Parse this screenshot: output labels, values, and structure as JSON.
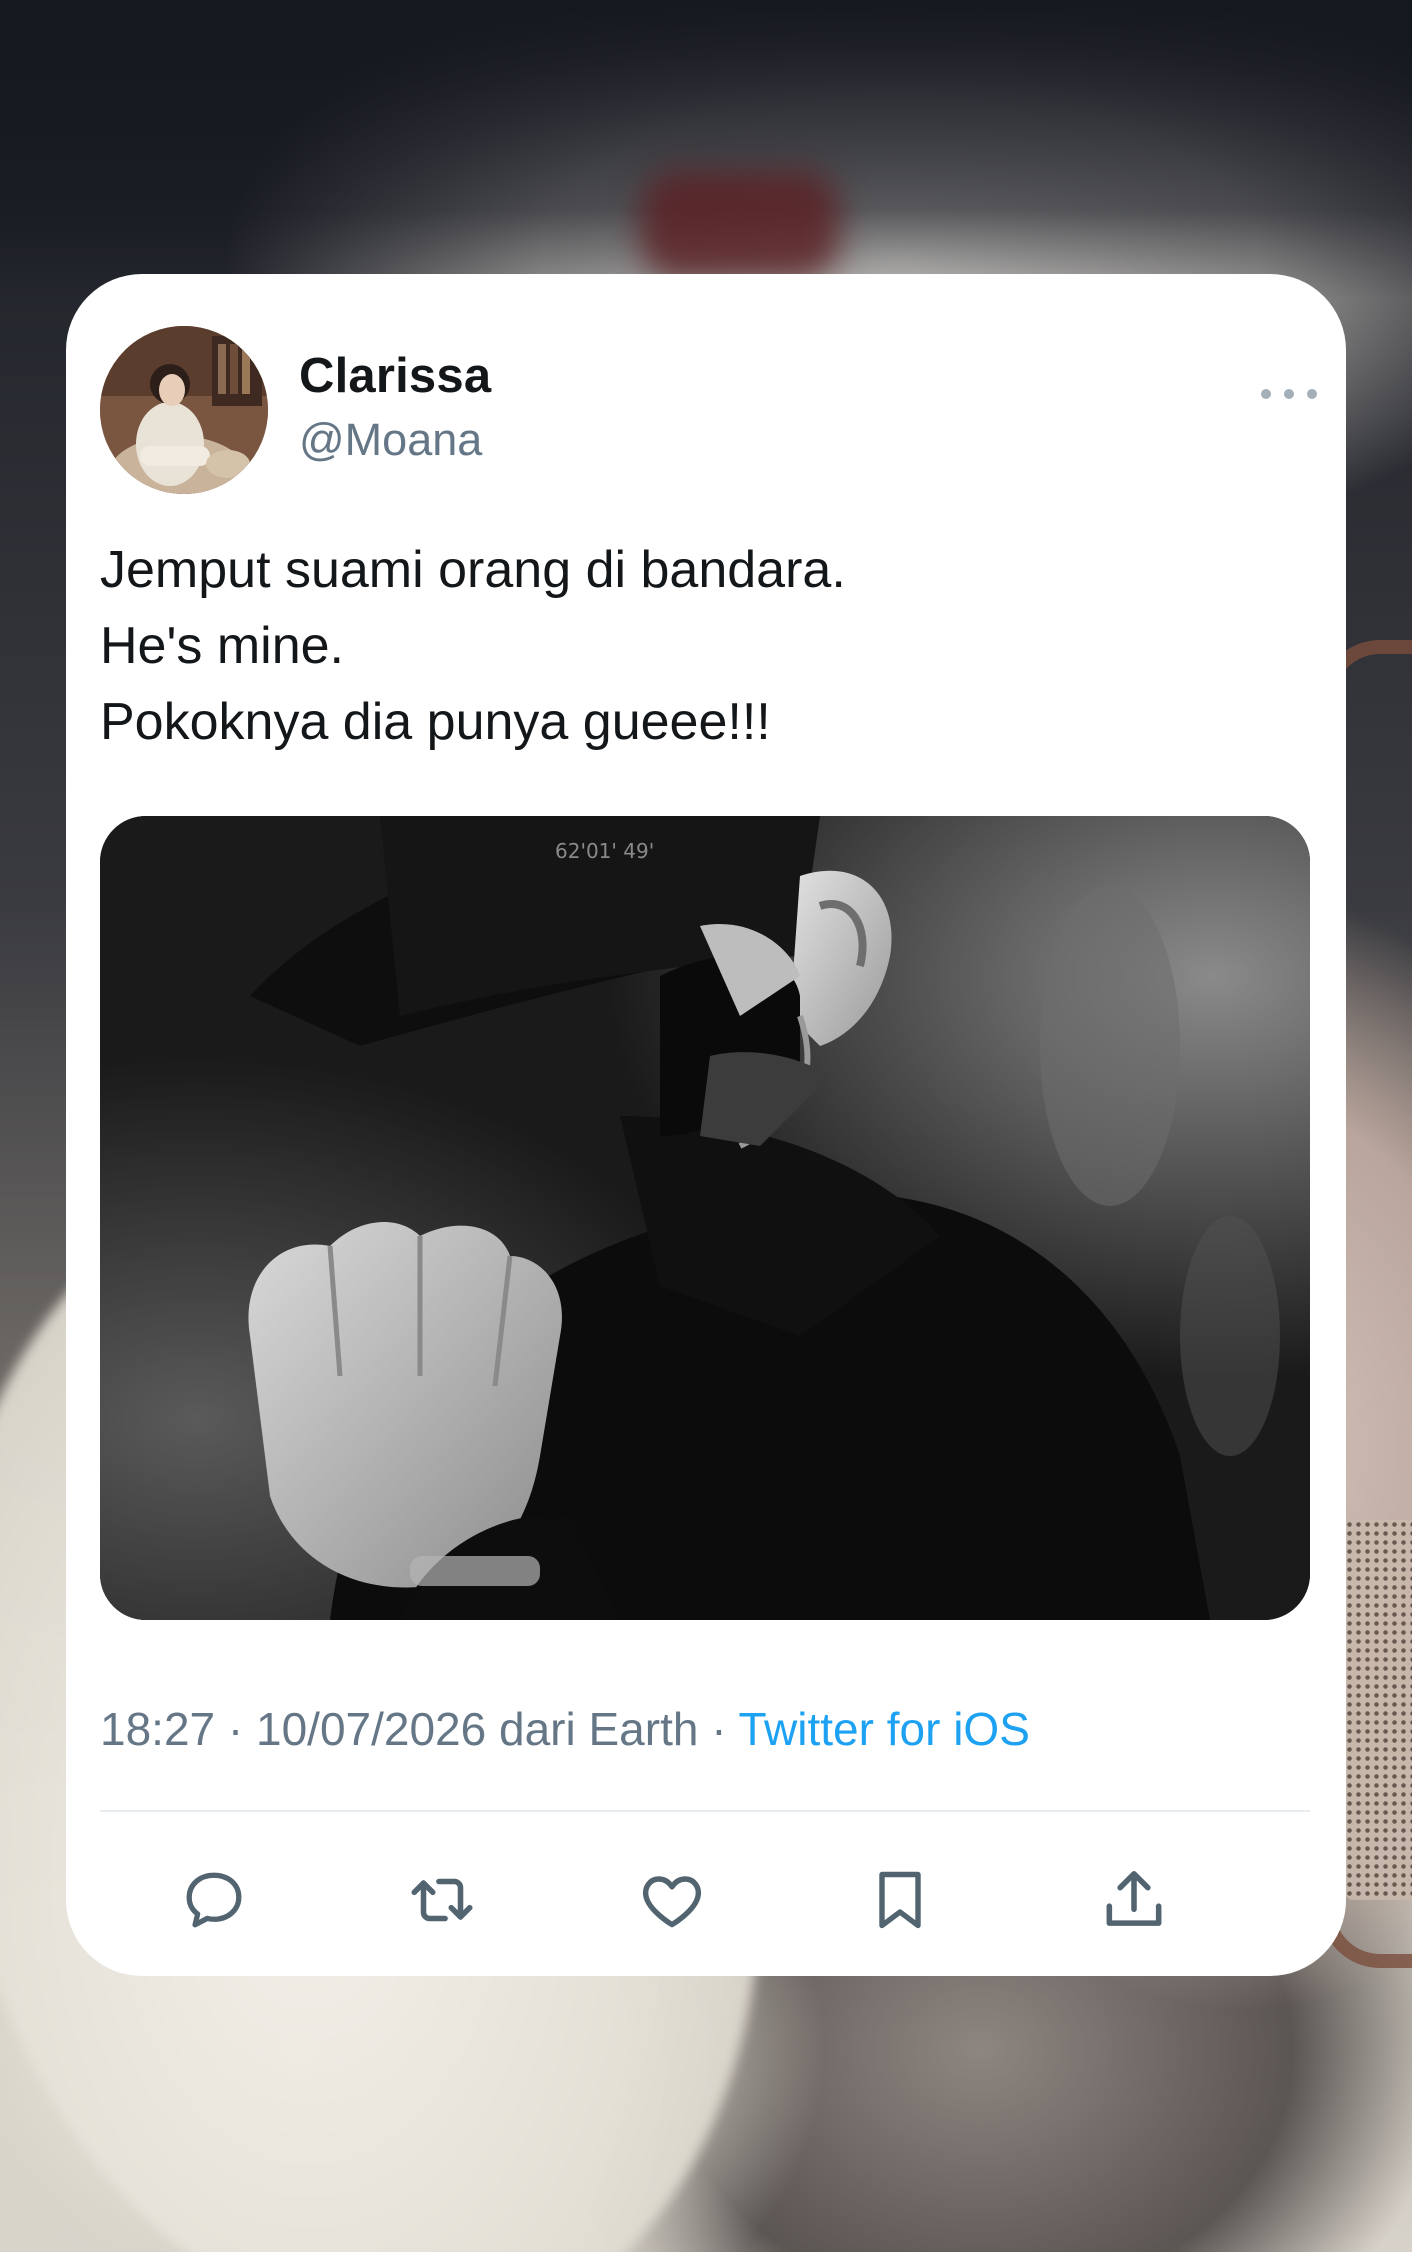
{
  "tweet": {
    "author_name": "Clarissa",
    "author_handle": "@Moana",
    "text_lines": [
      "Jemput suami orang di bandara.",
      "He's mine.",
      "Pokoknya dia punya gueee!!!"
    ],
    "media": {
      "icon": "photo-man-in-cap",
      "cap_text": "62'01' 49'"
    },
    "timestamp": "18:27 · 10/07/2026 dari Earth · ",
    "source": "Twitter for iOS",
    "more_icon": "more-dots-icon",
    "actions": [
      {
        "name": "reply",
        "icon": "reply-icon"
      },
      {
        "name": "retweet",
        "icon": "retweet-icon"
      },
      {
        "name": "like",
        "icon": "heart-icon"
      },
      {
        "name": "bookmark",
        "icon": "bookmark-icon"
      },
      {
        "name": "share",
        "icon": "share-icon"
      }
    ]
  },
  "colors": {
    "card_bg": "#ffffff",
    "text_primary": "#14171a",
    "text_secondary": "#657786",
    "link": "#1da1f2",
    "icon": "#536471"
  }
}
